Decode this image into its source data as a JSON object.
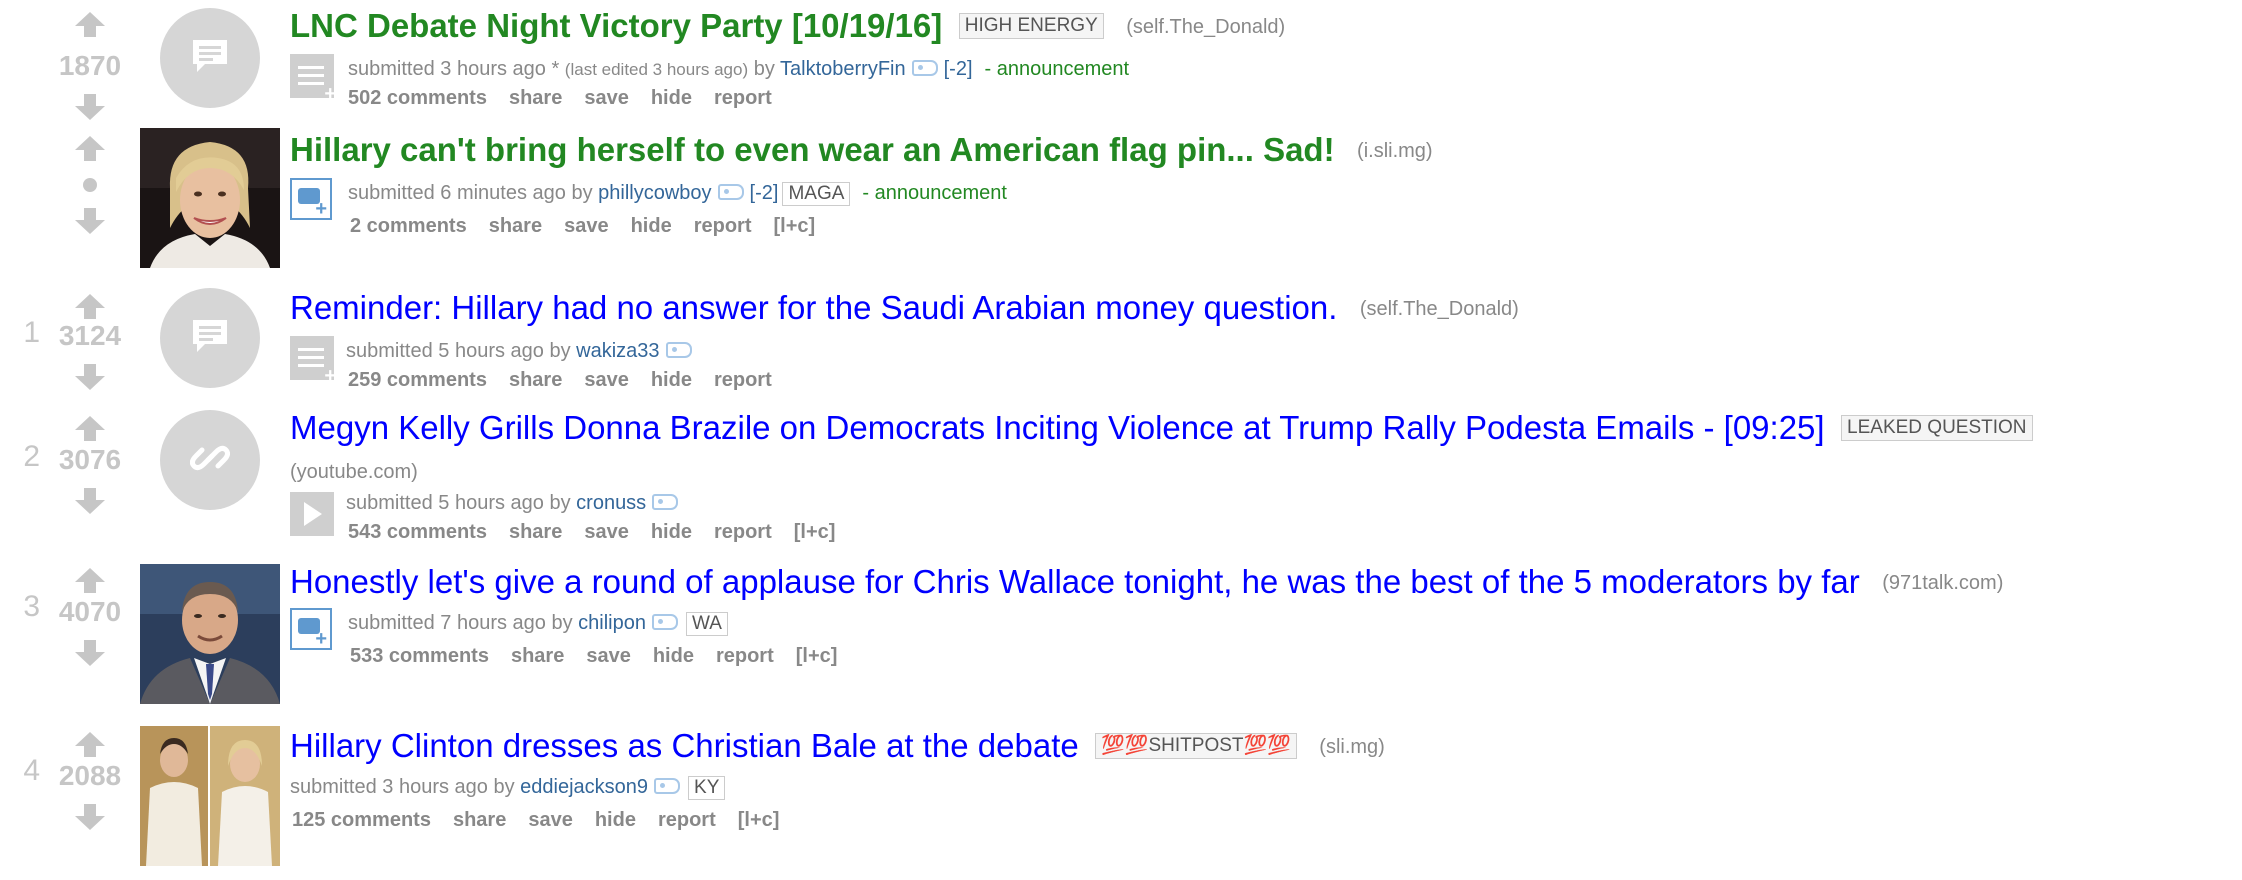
{
  "posts": [
    {
      "rank": "",
      "score": "1870",
      "title": "LNC Debate Night Victory Party [10/19/16]",
      "title_style": "green",
      "link_flair": "HIGH ENERGY",
      "domain": "(self.The_Donald)",
      "thumb": "self",
      "expando": "text",
      "submitted": "submitted 3 hours ago * ",
      "edited": "(last edited 3 hours ago)",
      "by": " by ",
      "author": "TalktoberryFin",
      "score_flair": "[-2]",
      "user_flair": "",
      "distinguish": "- announcement",
      "comments": "502 comments",
      "buttons": [
        "share",
        "save",
        "hide",
        "report"
      ]
    },
    {
      "rank": "",
      "score": "",
      "title": "Hillary can't bring herself to even wear an American flag pin... Sad!",
      "title_style": "green",
      "link_flair": "",
      "domain": "(i.sli.mg)",
      "thumb": "photo-hillary",
      "expando": "image",
      "submitted": "submitted 6 minutes ago",
      "edited": "",
      "by": " by ",
      "author": "phillycowboy",
      "score_flair": "[-2]",
      "user_flair": "MAGA",
      "distinguish": "- announcement",
      "comments": "2 comments",
      "buttons": [
        "share",
        "save",
        "hide",
        "report",
        "[l+c]"
      ]
    },
    {
      "rank": "1",
      "score": "3124",
      "title": "Reminder: Hillary had no answer for the Saudi Arabian money question.",
      "title_style": "blue",
      "link_flair": "",
      "domain": "(self.The_Donald)",
      "thumb": "self",
      "expando": "text",
      "submitted": "submitted 5 hours ago",
      "edited": "",
      "by": " by ",
      "author": "wakiza33",
      "score_flair": "",
      "user_flair": "",
      "distinguish": "",
      "comments": "259 comments",
      "buttons": [
        "share",
        "save",
        "hide",
        "report"
      ]
    },
    {
      "rank": "2",
      "score": "3076",
      "title": "Megyn Kelly Grills Donna Brazile on Democrats Inciting Violence at Trump Rally Podesta Emails - [09:25]",
      "title_style": "blue",
      "link_flair": "LEAKED QUESTION",
      "domain": "(youtube.com)",
      "thumb": "link",
      "expando": "video",
      "submitted": "submitted 5 hours ago",
      "edited": "",
      "by": " by ",
      "author": "cronuss",
      "score_flair": "",
      "user_flair": "",
      "distinguish": "",
      "comments": "543 comments",
      "buttons": [
        "share",
        "save",
        "hide",
        "report",
        "[l+c]"
      ]
    },
    {
      "rank": "3",
      "score": "4070",
      "title": "Honestly let's give a round of applause for Chris Wallace tonight, he was the best of the 5 moderators by far",
      "title_style": "blue",
      "link_flair": "",
      "domain": "(971talk.com)",
      "thumb": "photo-wallace",
      "expando": "image",
      "submitted": "submitted 7 hours ago",
      "edited": "",
      "by": " by ",
      "author": "chilipon",
      "score_flair": "",
      "user_flair": "WA",
      "distinguish": "",
      "comments": "533 comments",
      "buttons": [
        "share",
        "save",
        "hide",
        "report",
        "[l+c]"
      ]
    },
    {
      "rank": "4",
      "score": "2088",
      "title": "Hillary Clinton dresses as Christian Bale at the debate",
      "title_style": "blue",
      "link_flair": "💯💯SHITPOST💯💯",
      "domain": "(sli.mg)",
      "thumb": "photo-bale",
      "expando": "",
      "submitted": "submitted 3 hours ago",
      "edited": "",
      "by": " by ",
      "author": "eddiejackson9",
      "score_flair": "",
      "user_flair": "KY",
      "distinguish": "",
      "comments": "125 comments",
      "buttons": [
        "share",
        "save",
        "hide",
        "report",
        "[l+c]"
      ]
    }
  ]
}
